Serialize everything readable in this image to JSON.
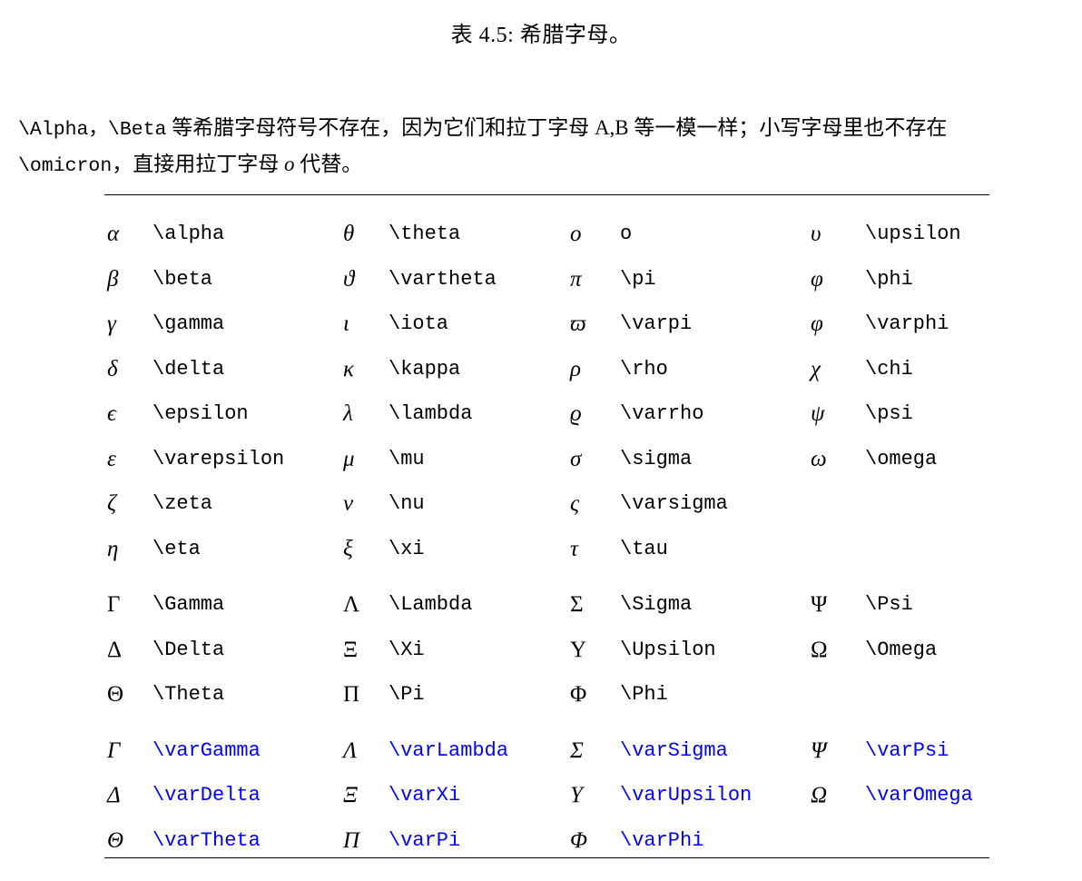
{
  "caption": {
    "label": "表 4.5: 希腊字母。"
  },
  "intro": {
    "line1_part1": "\\Alpha，\\Beta",
    "line1_part2": " 等希腊字母符号不存在，因为它们和拉丁字母 ",
    "line1_part3": "A,B",
    "line1_part4": " 等一模一样；小写字母里也不存在",
    "line2_part1": "\\omicron",
    "line2_part2": "，直接用拉丁字母 ",
    "line2_part3": "o",
    "line2_part4": " 代替。"
  },
  "colors": {
    "var_command": "#0000ff",
    "text": "#000000",
    "rule": "#000000"
  },
  "table": {
    "groups": [
      {
        "name": "lowercase",
        "rows": [
          [
            {
              "symbol": "α",
              "command": "\\alpha",
              "style": "italic",
              "color": "black"
            },
            {
              "symbol": "θ",
              "command": "\\theta",
              "style": "italic",
              "color": "black"
            },
            {
              "symbol": "o",
              "command": "o",
              "style": "italic",
              "color": "black"
            },
            {
              "symbol": "υ",
              "command": "\\upsilon",
              "style": "italic",
              "color": "black"
            }
          ],
          [
            {
              "symbol": "β",
              "command": "\\beta",
              "style": "italic",
              "color": "black"
            },
            {
              "symbol": "ϑ",
              "command": "\\vartheta",
              "style": "italic",
              "color": "black"
            },
            {
              "symbol": "π",
              "command": "\\pi",
              "style": "italic",
              "color": "black"
            },
            {
              "symbol": "φ",
              "command": "\\phi",
              "style": "italic",
              "color": "black"
            }
          ],
          [
            {
              "symbol": "γ",
              "command": "\\gamma",
              "style": "italic",
              "color": "black"
            },
            {
              "symbol": "ι",
              "command": "\\iota",
              "style": "italic",
              "color": "black"
            },
            {
              "symbol": "ϖ",
              "command": "\\varpi",
              "style": "italic",
              "color": "black"
            },
            {
              "symbol": "φ",
              "command": "\\varphi",
              "style": "italic",
              "color": "black"
            }
          ],
          [
            {
              "symbol": "δ",
              "command": "\\delta",
              "style": "italic",
              "color": "black"
            },
            {
              "symbol": "κ",
              "command": "\\kappa",
              "style": "italic",
              "color": "black"
            },
            {
              "symbol": "ρ",
              "command": "\\rho",
              "style": "italic",
              "color": "black"
            },
            {
              "symbol": "χ",
              "command": "\\chi",
              "style": "italic",
              "color": "black"
            }
          ],
          [
            {
              "symbol": "ϵ",
              "command": "\\epsilon",
              "style": "italic",
              "color": "black"
            },
            {
              "symbol": "λ",
              "command": "\\lambda",
              "style": "italic",
              "color": "black"
            },
            {
              "symbol": "ϱ",
              "command": "\\varrho",
              "style": "italic",
              "color": "black"
            },
            {
              "symbol": "ψ",
              "command": "\\psi",
              "style": "italic",
              "color": "black"
            }
          ],
          [
            {
              "symbol": "ε",
              "command": "\\varepsilon",
              "style": "italic",
              "color": "black"
            },
            {
              "symbol": "μ",
              "command": "\\mu",
              "style": "italic",
              "color": "black"
            },
            {
              "symbol": "σ",
              "command": "\\sigma",
              "style": "italic",
              "color": "black"
            },
            {
              "symbol": "ω",
              "command": "\\omega",
              "style": "italic",
              "color": "black"
            }
          ],
          [
            {
              "symbol": "ζ",
              "command": "\\zeta",
              "style": "italic",
              "color": "black"
            },
            {
              "symbol": "ν",
              "command": "\\nu",
              "style": "italic",
              "color": "black"
            },
            {
              "symbol": "ς",
              "command": "\\varsigma",
              "style": "italic",
              "color": "black"
            },
            {
              "symbol": "",
              "command": "",
              "style": "italic",
              "color": "black"
            }
          ],
          [
            {
              "symbol": "η",
              "command": "\\eta",
              "style": "italic",
              "color": "black"
            },
            {
              "symbol": "ξ",
              "command": "\\xi",
              "style": "italic",
              "color": "black"
            },
            {
              "symbol": "τ",
              "command": "\\tau",
              "style": "italic",
              "color": "black"
            },
            {
              "symbol": "",
              "command": "",
              "style": "italic",
              "color": "black"
            }
          ]
        ]
      },
      {
        "name": "uppercase",
        "rows": [
          [
            {
              "symbol": "Γ",
              "command": "\\Gamma",
              "style": "upright",
              "color": "black"
            },
            {
              "symbol": "Λ",
              "command": "\\Lambda",
              "style": "upright",
              "color": "black"
            },
            {
              "symbol": "Σ",
              "command": "\\Sigma",
              "style": "upright",
              "color": "black"
            },
            {
              "symbol": "Ψ",
              "command": "\\Psi",
              "style": "upright",
              "color": "black"
            }
          ],
          [
            {
              "symbol": "Δ",
              "command": "\\Delta",
              "style": "upright",
              "color": "black"
            },
            {
              "symbol": "Ξ",
              "command": "\\Xi",
              "style": "upright",
              "color": "black"
            },
            {
              "symbol": "Υ",
              "command": "\\Upsilon",
              "style": "upright",
              "color": "black"
            },
            {
              "symbol": "Ω",
              "command": "\\Omega",
              "style": "upright",
              "color": "black"
            }
          ],
          [
            {
              "symbol": "Θ",
              "command": "\\Theta",
              "style": "upright",
              "color": "black"
            },
            {
              "symbol": "Π",
              "command": "\\Pi",
              "style": "upright",
              "color": "black"
            },
            {
              "symbol": "Φ",
              "command": "\\Phi",
              "style": "upright",
              "color": "black"
            },
            {
              "symbol": "",
              "command": "",
              "style": "upright",
              "color": "black"
            }
          ]
        ]
      },
      {
        "name": "uppercase-italic-var",
        "rows": [
          [
            {
              "symbol": "Γ",
              "command": "\\varGamma",
              "style": "slanted",
              "color": "blue"
            },
            {
              "symbol": "Λ",
              "command": "\\varLambda",
              "style": "slanted",
              "color": "blue"
            },
            {
              "symbol": "Σ",
              "command": "\\varSigma",
              "style": "slanted",
              "color": "blue"
            },
            {
              "symbol": "Ψ",
              "command": "\\varPsi",
              "style": "slanted",
              "color": "blue"
            }
          ],
          [
            {
              "symbol": "Δ",
              "command": "\\varDelta",
              "style": "slanted",
              "color": "blue"
            },
            {
              "symbol": "Ξ",
              "command": "\\varXi",
              "style": "slanted",
              "color": "blue"
            },
            {
              "symbol": "Υ",
              "command": "\\varUpsilon",
              "style": "slanted",
              "color": "blue"
            },
            {
              "symbol": "Ω",
              "command": "\\varOmega",
              "style": "slanted",
              "color": "blue"
            }
          ],
          [
            {
              "symbol": "Θ",
              "command": "\\varTheta",
              "style": "slanted",
              "color": "blue"
            },
            {
              "symbol": "Π",
              "command": "\\varPi",
              "style": "slanted",
              "color": "blue"
            },
            {
              "symbol": "Φ",
              "command": "\\varPhi",
              "style": "slanted",
              "color": "blue"
            },
            {
              "symbol": "",
              "command": "",
              "style": "slanted",
              "color": "blue"
            }
          ]
        ]
      }
    ]
  }
}
